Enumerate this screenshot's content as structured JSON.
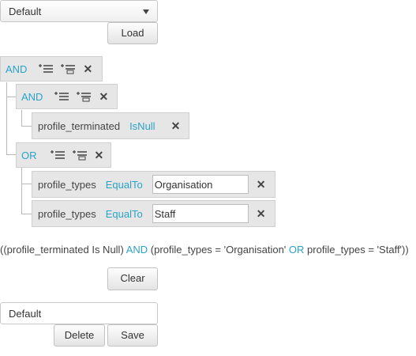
{
  "filter_select": {
    "value": "Default"
  },
  "load_button": "Load",
  "root_group": {
    "operator": "AND"
  },
  "group_1": {
    "operator": "AND",
    "rule": {
      "field": "profile_terminated",
      "condition": "IsNull"
    }
  },
  "group_2": {
    "operator": "OR",
    "rules": [
      {
        "field": "profile_types",
        "condition": "EqualTo",
        "value": "Organisation"
      },
      {
        "field": "profile_types",
        "condition": "EqualTo",
        "value": "Staff"
      }
    ]
  },
  "expression": {
    "part1": "((profile_terminated Is Null)",
    "op1": "AND",
    "part2": "(profile_types = 'Organisation'",
    "op2": "OR",
    "part3": "profile_types = 'Staff'))"
  },
  "clear_button": "Clear",
  "name_field": {
    "value": "Default"
  },
  "delete_button": "Delete",
  "save_button": "Save",
  "icons": {
    "add_rule": "add-rule-icon",
    "add_group": "add-group-icon",
    "remove": "close-icon"
  },
  "colors": {
    "operator": "#2aa3c9",
    "panel": "#e6e6e6"
  }
}
